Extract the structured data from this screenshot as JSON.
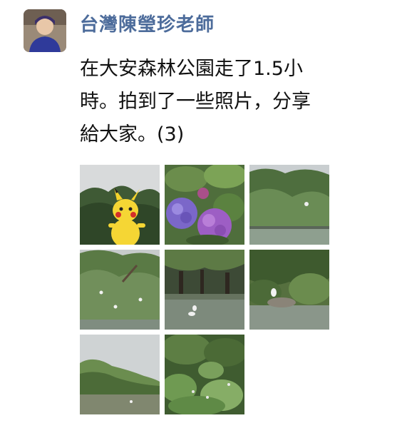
{
  "post": {
    "sender_name": "台灣陳瑩珍老師",
    "message_lines": [
      "在大安森林公園走了1.5小",
      "時。拍到了一些照片，分享",
      "給大家。(3)"
    ]
  },
  "photos": [
    {
      "subject": "pikachu-statue"
    },
    {
      "subject": "hydrangea-flowers"
    },
    {
      "subject": "pond-trees"
    },
    {
      "subject": "egret-trees"
    },
    {
      "subject": "pond-egret"
    },
    {
      "subject": "pond-egret-rocks"
    },
    {
      "subject": "pond-shrubs"
    },
    {
      "subject": "garden-greenery"
    }
  ],
  "colors": {
    "sender_name": "#4d6c9b",
    "message_text": "#111111",
    "background": "#ffffff"
  }
}
